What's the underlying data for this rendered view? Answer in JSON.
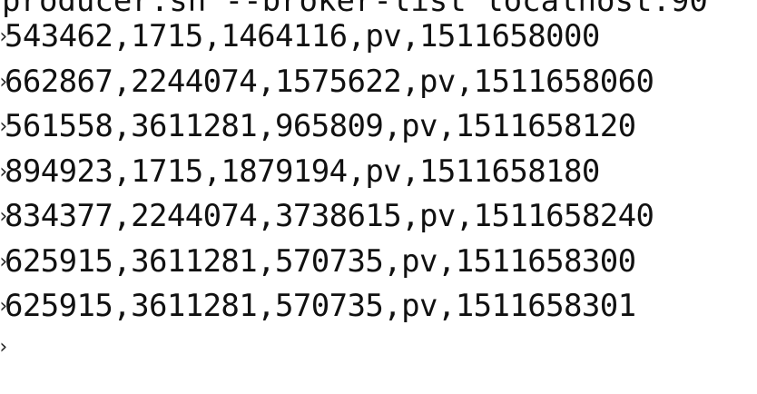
{
  "terminal": {
    "command_fragment": "producer.sh --broker-list localhost:90",
    "prompt_glyph": "›",
    "lines": [
      "543462,1715,1464116,pv,1511658000",
      "662867,2244074,1575622,pv,1511658060",
      "561558,3611281,965809,pv,1511658120",
      "894923,1715,1879194,pv,1511658180",
      "834377,2244074,3738615,pv,1511658240",
      "625915,3611281,570735,pv,1511658300",
      "625915,3611281,570735,pv,1511658301"
    ]
  }
}
